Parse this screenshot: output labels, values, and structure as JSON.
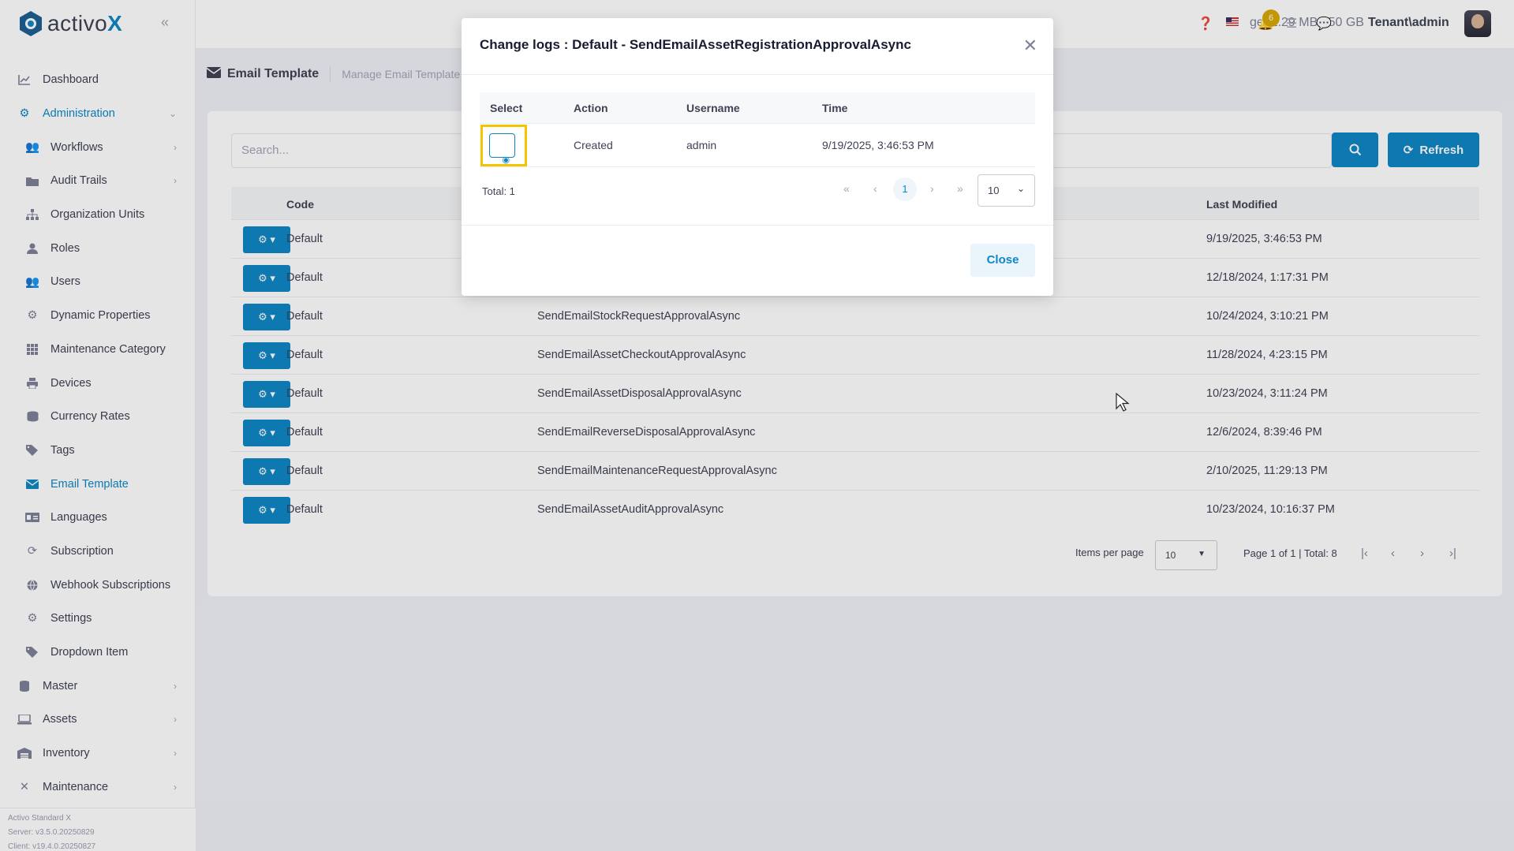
{
  "brand": {
    "name_prefix": "activo",
    "name_suffix": "X"
  },
  "sidebar": {
    "items": [
      {
        "label": "Dashboard",
        "icon": "chart-line-icon"
      },
      {
        "label": "Administration",
        "icon": "cogs-icon"
      },
      {
        "label": "Workflows",
        "icon": "users-icon"
      },
      {
        "label": "Audit Trails",
        "icon": "folder-icon"
      },
      {
        "label": "Organization Units",
        "icon": "sitemap-icon"
      },
      {
        "label": "Roles",
        "icon": "user-icon"
      },
      {
        "label": "Users",
        "icon": "users-icon"
      },
      {
        "label": "Dynamic Properties",
        "icon": "gear-icon"
      },
      {
        "label": "Maintenance Category",
        "icon": "grid-icon"
      },
      {
        "label": "Devices",
        "icon": "printer-icon"
      },
      {
        "label": "Currency Rates",
        "icon": "coins-icon"
      },
      {
        "label": "Tags",
        "icon": "tags-icon"
      },
      {
        "label": "Email Template",
        "icon": "envelope-icon"
      },
      {
        "label": "Languages",
        "icon": "language-icon"
      },
      {
        "label": "Subscription",
        "icon": "sync-icon"
      },
      {
        "label": "Webhook Subscriptions",
        "icon": "globe-icon"
      },
      {
        "label": "Settings",
        "icon": "gear-icon"
      },
      {
        "label": "Dropdown Item",
        "icon": "tags-icon"
      },
      {
        "label": "Master",
        "icon": "database-icon"
      },
      {
        "label": "Assets",
        "icon": "laptop-icon"
      },
      {
        "label": "Inventory",
        "icon": "warehouse-icon"
      },
      {
        "label": "Maintenance",
        "icon": "tools-icon"
      }
    ],
    "version": {
      "edition": "Activo Standard X",
      "server": "Server: v3.5.0.20250829",
      "client": "Client: v19.4.0.20250827"
    }
  },
  "header": {
    "storage": "ge: 2.29 MB / 50 GB",
    "notification_count": "6",
    "user": "Tenant\\admin"
  },
  "page": {
    "title": "Email Template",
    "description": "Manage Email Template"
  },
  "search": {
    "placeholder": "Search...",
    "refresh_label": "Refresh"
  },
  "grid": {
    "columns": {
      "code": "Code",
      "last_modified": "Last Modified"
    },
    "rows": [
      {
        "code": "Default",
        "name": "",
        "modified": "9/19/2025, 3:46:53 PM"
      },
      {
        "code": "Default",
        "name": "",
        "modified": "12/18/2024, 1:17:31 PM"
      },
      {
        "code": "Default",
        "name": "SendEmailStockRequestApprovalAsync",
        "modified": "10/24/2024, 3:10:21 PM"
      },
      {
        "code": "Default",
        "name": "SendEmailAssetCheckoutApprovalAsync",
        "modified": "11/28/2024, 4:23:15 PM"
      },
      {
        "code": "Default",
        "name": "SendEmailAssetDisposalApprovalAsync",
        "modified": "10/23/2024, 3:11:24 PM"
      },
      {
        "code": "Default",
        "name": "SendEmailReverseDisposalApprovalAsync",
        "modified": "12/6/2024, 8:39:46 PM"
      },
      {
        "code": "Default",
        "name": "SendEmailMaintenanceRequestApprovalAsync",
        "modified": "2/10/2025, 11:29:13 PM"
      },
      {
        "code": "Default",
        "name": "SendEmailAssetAuditApprovalAsync",
        "modified": "10/23/2024, 10:16:37 PM"
      }
    ],
    "items_per_page_label": "Items per page",
    "items_per_page": "10",
    "page_info": "Page 1 of 1 | Total: 8"
  },
  "modal": {
    "title": "Change logs : Default - SendEmailAssetRegistrationApprovalAsync",
    "columns": {
      "select": "Select",
      "action": "Action",
      "username": "Username",
      "time": "Time"
    },
    "row": {
      "action": "Created",
      "username": "admin",
      "time": "9/19/2025, 3:46:53 PM"
    },
    "total": "Total: 1",
    "current_page": "1",
    "page_size": "10",
    "close_label": "Close"
  }
}
